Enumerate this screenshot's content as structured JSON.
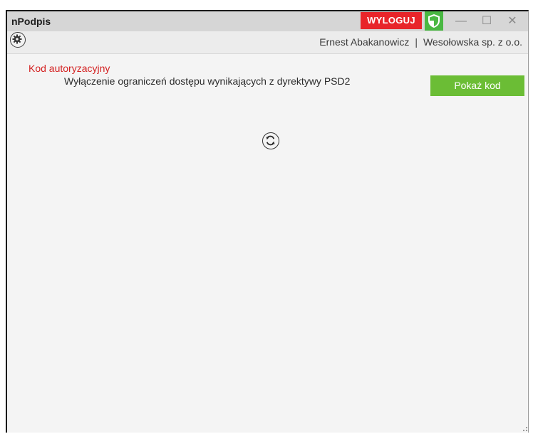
{
  "window": {
    "title": "nPodpis",
    "logout_label": "WYLOGUJ",
    "minimize_label": "—",
    "maximize_label": "☐",
    "close_label": "✕",
    "shield_icon": "shield-icon"
  },
  "toolbar": {
    "settings_icon": "gear-icon",
    "user_name": "Ernest Abakanowicz",
    "separator": "|",
    "company": "Wesołowska sp. z o.o."
  },
  "main": {
    "section_title": "Kod autoryzacyjny",
    "section_description": "Wyłączenie ograniczeń dostępu wynikających z dyrektywy PSD2",
    "show_code_label": "Pokaż kod",
    "refresh_icon": "refresh-icon"
  },
  "colors": {
    "logout": "#e8252a",
    "shield": "#49b842",
    "accent_button": "#6bbd35",
    "section_title": "#d42222"
  }
}
